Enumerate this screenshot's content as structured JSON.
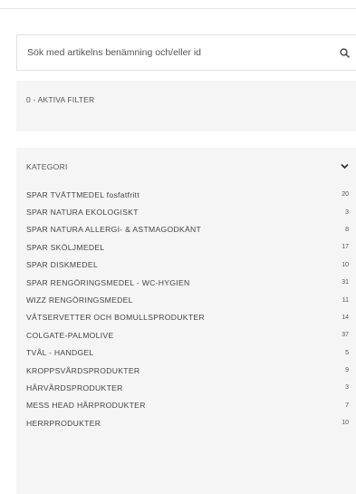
{
  "search": {
    "placeholder": "Sök med artikelns benämning och/eller id",
    "icon": "search-icon"
  },
  "filters": {
    "label": "0 - AKTIVA FILTER"
  },
  "category": {
    "title": "KATEGORI",
    "items": [
      {
        "label": "SPAR TVÄTTMEDEL fosfatfritt",
        "count": "20"
      },
      {
        "label": "SPAR NATURA EKOLOGISKT",
        "count": "3"
      },
      {
        "label": "SPAR NATURA ALLERGI- & ASTMAGODKÄNT",
        "count": "8"
      },
      {
        "label": "SPAR SKÖLJMEDEL",
        "count": "17"
      },
      {
        "label": "SPAR DISKMEDEL",
        "count": "10"
      },
      {
        "label": "SPAR RENGÖRINGSMEDEL - WC-HYGIEN",
        "count": "31"
      },
      {
        "label": "WIZZ RENGÖRINGSMEDEL",
        "count": "11"
      },
      {
        "label": "VÅTSERVETTER OCH BOMULLSPRODUKTER",
        "count": "14"
      },
      {
        "label": "COLGATE-PALMOLIVE",
        "count": "37"
      },
      {
        "label": "TVÅL - HANDGEL",
        "count": "5"
      },
      {
        "label": "KROPPSVÅRDSPRODUKTER",
        "count": "9"
      },
      {
        "label": "HÅRVÅRDSPRODUKTER",
        "count": "3"
      },
      {
        "label": "MESS HEAD HÅRPRODUKTER",
        "count": "7"
      },
      {
        "label": "HERRPRODUKTER",
        "count": "10"
      }
    ]
  }
}
